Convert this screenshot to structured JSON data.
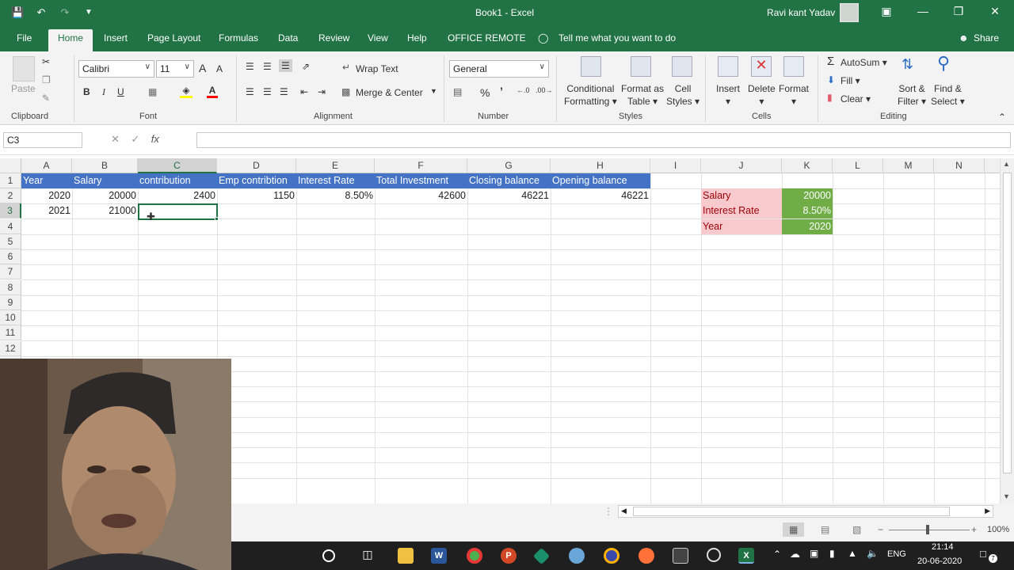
{
  "window": {
    "title": "Book1  -  Excel",
    "user": "Ravi kant Yadav"
  },
  "tabs": [
    "File",
    "Home",
    "Insert",
    "Page Layout",
    "Formulas",
    "Data",
    "Review",
    "View",
    "Help",
    "OFFICE REMOTE"
  ],
  "tell_me": "Tell me what you want to do",
  "share": "Share",
  "ribbon": {
    "clipboard": {
      "paste": "Paste",
      "label": "Clipboard"
    },
    "font": {
      "name": "Calibri",
      "size": "11",
      "bold": "B",
      "italic": "I",
      "underline": "U",
      "label": "Font"
    },
    "alignment": {
      "wrap": "Wrap Text",
      "merge": "Merge & Center",
      "label": "Alignment"
    },
    "number": {
      "format": "General",
      "percent": "%",
      "comma": "’",
      "label": "Number"
    },
    "styles": {
      "cond1": "Conditional",
      "cond2": "Formatting",
      "fmt1": "Format as",
      "fmt2": "Table",
      "cell1": "Cell",
      "cell2": "Styles",
      "label": "Styles"
    },
    "cells": {
      "insert": "Insert",
      "delete": "Delete",
      "format": "Format",
      "label": "Cells"
    },
    "editing": {
      "autosum": "AutoSum",
      "fill": "Fill",
      "clear": "Clear",
      "sort1": "Sort &",
      "sort2": "Filter",
      "find1": "Find &",
      "find2": "Select",
      "label": "Editing"
    }
  },
  "formula_bar": {
    "name_box": "C3",
    "fx": "fx",
    "value": ""
  },
  "columns": [
    "A",
    "B",
    "C",
    "D",
    "E",
    "F",
    "G",
    "H",
    "I",
    "J",
    "K",
    "L",
    "M",
    "N"
  ],
  "rows": [
    "1",
    "2",
    "3",
    "4",
    "5",
    "6",
    "7",
    "8",
    "9",
    "10",
    "11",
    "12"
  ],
  "sheet": {
    "headers": [
      "Year",
      "Salary",
      "contribution",
      "Emp contribtion",
      "Interest Rate",
      "Total Investment",
      "Closing balance",
      "Opening balance"
    ],
    "row2": [
      "2020",
      "20000",
      "2400",
      "1150",
      "8.50%",
      "42600",
      "46221",
      "46221"
    ],
    "row3": [
      "2021",
      "21000"
    ],
    "side_labels": [
      "Salary",
      "Interest Rate",
      "Year"
    ],
    "side_values": [
      "20000",
      "8.50%",
      "2020"
    ]
  },
  "status": {
    "zoom": "100%"
  },
  "taskbar": {
    "lang": "ENG",
    "time": "21:14",
    "date": "20-06-2020",
    "notif": "7"
  }
}
